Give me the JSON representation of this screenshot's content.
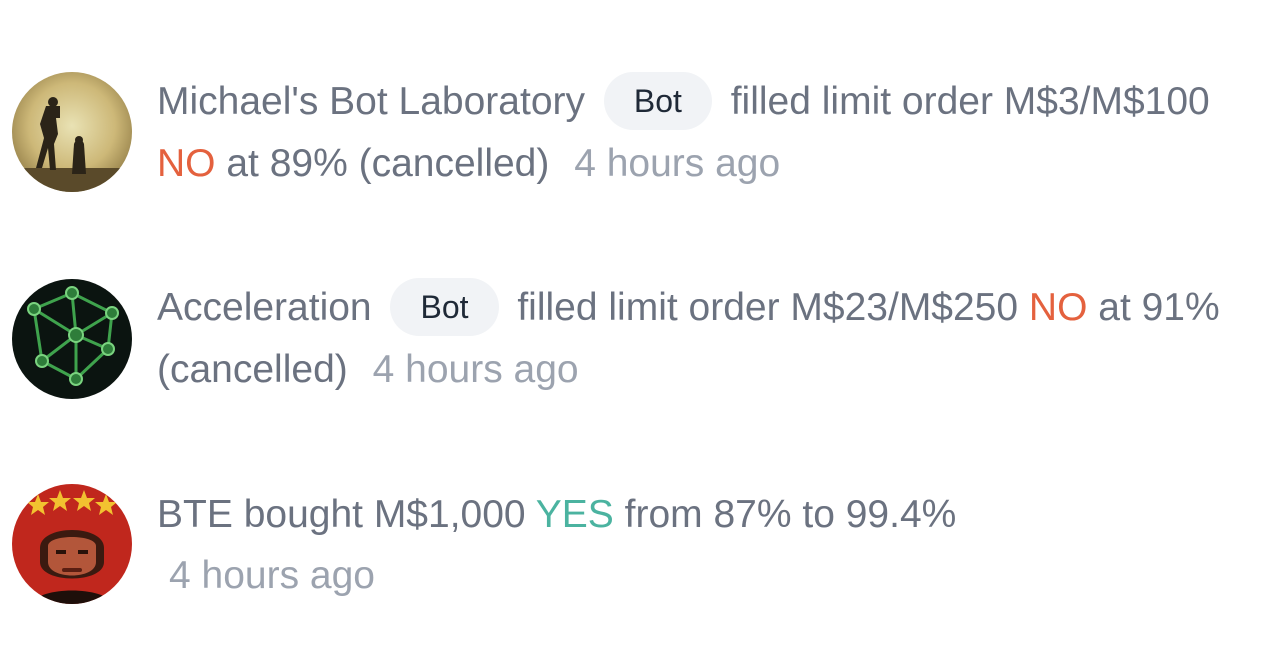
{
  "feed": [
    {
      "avatar_icon": "robot-silhouette-avatar",
      "user": "Michael's Bot Laboratory",
      "badge": "Bot",
      "action": "filled limit order M$3/M$100",
      "outcome": "NO",
      "outcome_color": "#e4613e",
      "details": "at 89% (cancelled)",
      "time": "4 hours ago"
    },
    {
      "avatar_icon": "green-network-avatar",
      "user": "Acceleration",
      "badge": "Bot",
      "action": "filled limit order M$23/M$250",
      "outcome": "NO",
      "outcome_color": "#e4613e",
      "details": "at 91% (cancelled)",
      "time": "4 hours ago"
    },
    {
      "avatar_icon": "red-stars-portrait-avatar",
      "user": "BTE",
      "action": "bought M$1,000",
      "outcome": "YES",
      "outcome_color": "#4bb3a0",
      "details": "from 87% to 99.4%",
      "time": "4 hours ago"
    }
  ],
  "colors": {
    "text": "#6b7280",
    "muted": "#9ca3af",
    "badge_bg": "#f1f3f6",
    "no": "#e4613e",
    "yes": "#4bb3a0"
  }
}
